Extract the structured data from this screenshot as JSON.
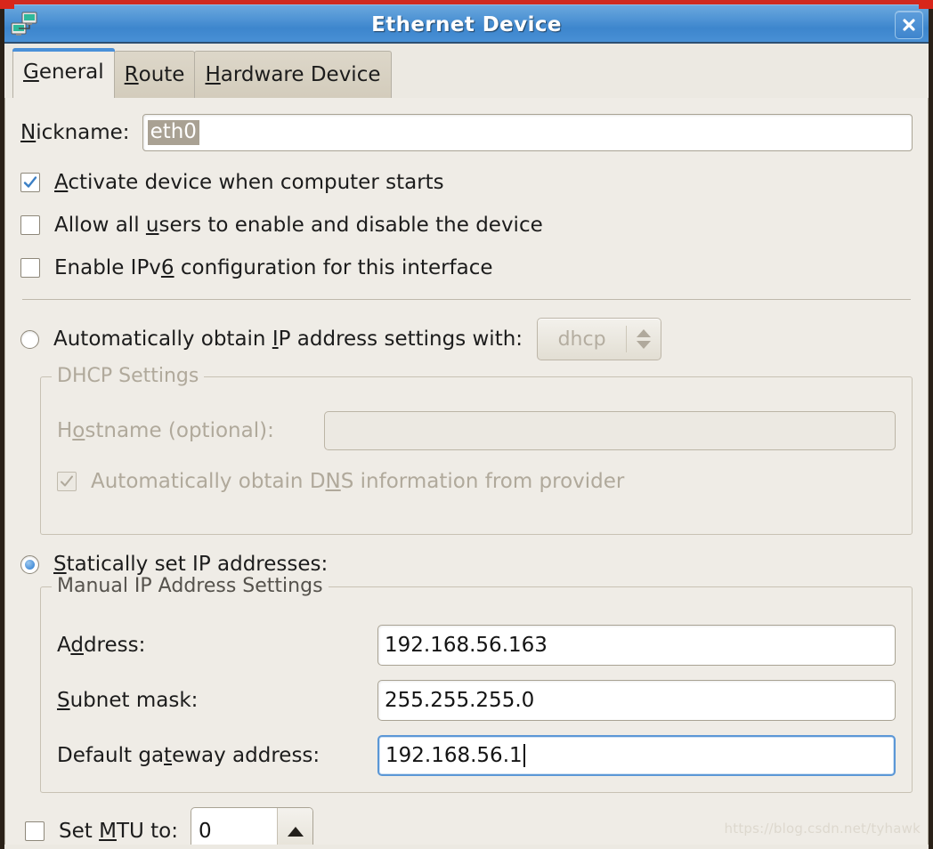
{
  "window": {
    "title": "Ethernet Device",
    "icon": "network-devices-icon",
    "close_label": "✕",
    "frame_accent_color": "#d8261a",
    "titlebar_color": "#4e93d4"
  },
  "tabs": [
    {
      "label": "General",
      "mnemonic": "G",
      "active": true
    },
    {
      "label": "Route",
      "mnemonic": "R",
      "active": false
    },
    {
      "label": "Hardware Device",
      "mnemonic": "H",
      "active": false
    }
  ],
  "general": {
    "nickname": {
      "label": "Nickname:",
      "mnemonic": "N",
      "value": "eth0",
      "selected": true
    },
    "checkboxes": [
      {
        "label": "Activate device when computer starts",
        "mnemonic": "A",
        "checked": true,
        "disabled": false
      },
      {
        "label": "Allow all users to enable and disable the device",
        "mnemonic": "u",
        "checked": false,
        "disabled": false
      },
      {
        "label": "Enable IPv6 configuration for this interface",
        "mnemonic": "6",
        "checked": false,
        "disabled": false
      }
    ],
    "auto_option": {
      "label": "Automatically obtain IP address settings with:",
      "mnemonic": "I",
      "selected": false,
      "combo_value": "dhcp",
      "combo_disabled": true
    },
    "dhcp_group": {
      "title": "DHCP Settings",
      "disabled": true,
      "hostname": {
        "label": "Hostname (optional):",
        "mnemonic": "o",
        "value": "",
        "placeholder": ""
      },
      "dns_checkbox": {
        "label": "Automatically obtain DNS information from provider",
        "mnemonic": "N",
        "checked": true,
        "disabled": true
      }
    },
    "static_option": {
      "label": "Statically set IP addresses:",
      "mnemonic": "S",
      "selected": true
    },
    "manual_group": {
      "title": "Manual IP Address Settings",
      "fields": [
        {
          "label": "Address:",
          "mnemonic": "d",
          "value": "192.168.56.163",
          "focused": false
        },
        {
          "label": "Subnet mask:",
          "mnemonic": "S",
          "value": "255.255.255.0",
          "focused": false
        },
        {
          "label": "Default gateway address:",
          "mnemonic": "t",
          "value": "192.168.56.1",
          "focused": true
        }
      ]
    },
    "mtu": {
      "label": "Set MTU to:",
      "mnemonic": "M",
      "checked": false,
      "value": "0"
    }
  },
  "watermark": "https://blog.csdn.net/tyhawk"
}
